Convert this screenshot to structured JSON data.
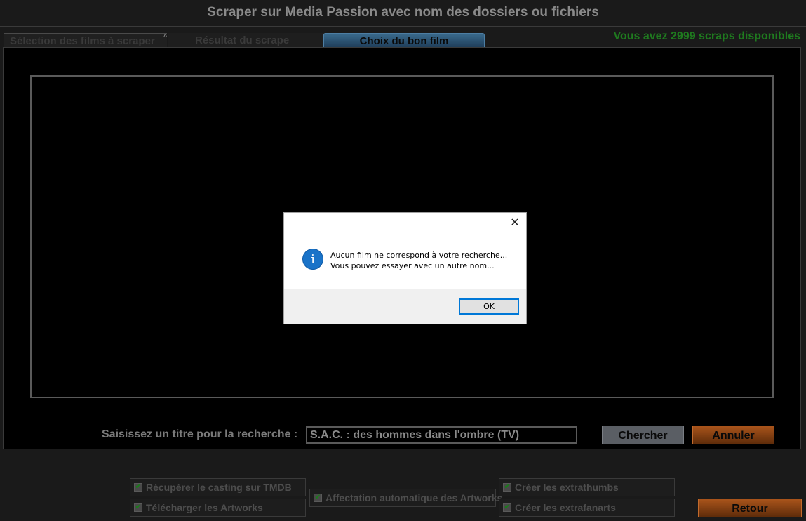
{
  "window": {
    "title": "Scraper sur Media Passion avec nom des dossiers ou fichiers"
  },
  "tabs": [
    {
      "label": "Sélection des films à scraper"
    },
    {
      "label": "Résultat du scrape"
    },
    {
      "label": "Choix du bon film"
    }
  ],
  "scraps_available": "Vous avez 2999 scraps disponibles",
  "search": {
    "label": "Saisissez un titre pour la recherche :",
    "value": "S.A.C. : des hommes dans l'ombre (TV)"
  },
  "buttons": {
    "search": "Chercher",
    "cancel": "Annuler",
    "back": "Retour"
  },
  "options": [
    {
      "label": "Récupérer le casting sur TMDB",
      "checked": true
    },
    {
      "label": "Télécharger les Artworks",
      "checked": true
    },
    {
      "label": "Affectation automatique des Artworks",
      "checked": true
    },
    {
      "label": "Créer les extrathumbs",
      "checked": true
    },
    {
      "label": "Créer les extrafanarts",
      "checked": true
    }
  ],
  "dialog": {
    "line1": "Aucun film ne correspond à votre recherche...",
    "line2": "Vous pouvez essayer avec un autre nom...",
    "ok": "OK",
    "icon": "info-icon"
  },
  "colors": {
    "accent_green": "#1f7a1f",
    "orange_button": "#a9541b",
    "active_tab": "#2d5878"
  }
}
